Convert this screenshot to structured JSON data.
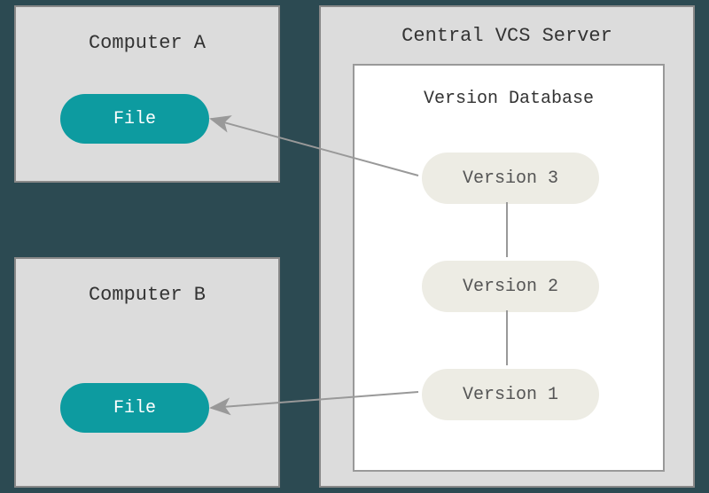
{
  "computer_a": {
    "title": "Computer A",
    "file_label": "File"
  },
  "computer_b": {
    "title": "Computer B",
    "file_label": "File"
  },
  "server": {
    "title": "Central VCS Server",
    "database": {
      "title": "Version Database",
      "versions": {
        "v3": "Version 3",
        "v2": "Version 2",
        "v1": "Version 1"
      }
    }
  },
  "colors": {
    "background": "#2c4a52",
    "box_fill": "#dcdcdc",
    "box_border": "#888888",
    "file_pill": "#0d9ba0",
    "version_pill": "#edece4",
    "arrow": "#999999"
  }
}
